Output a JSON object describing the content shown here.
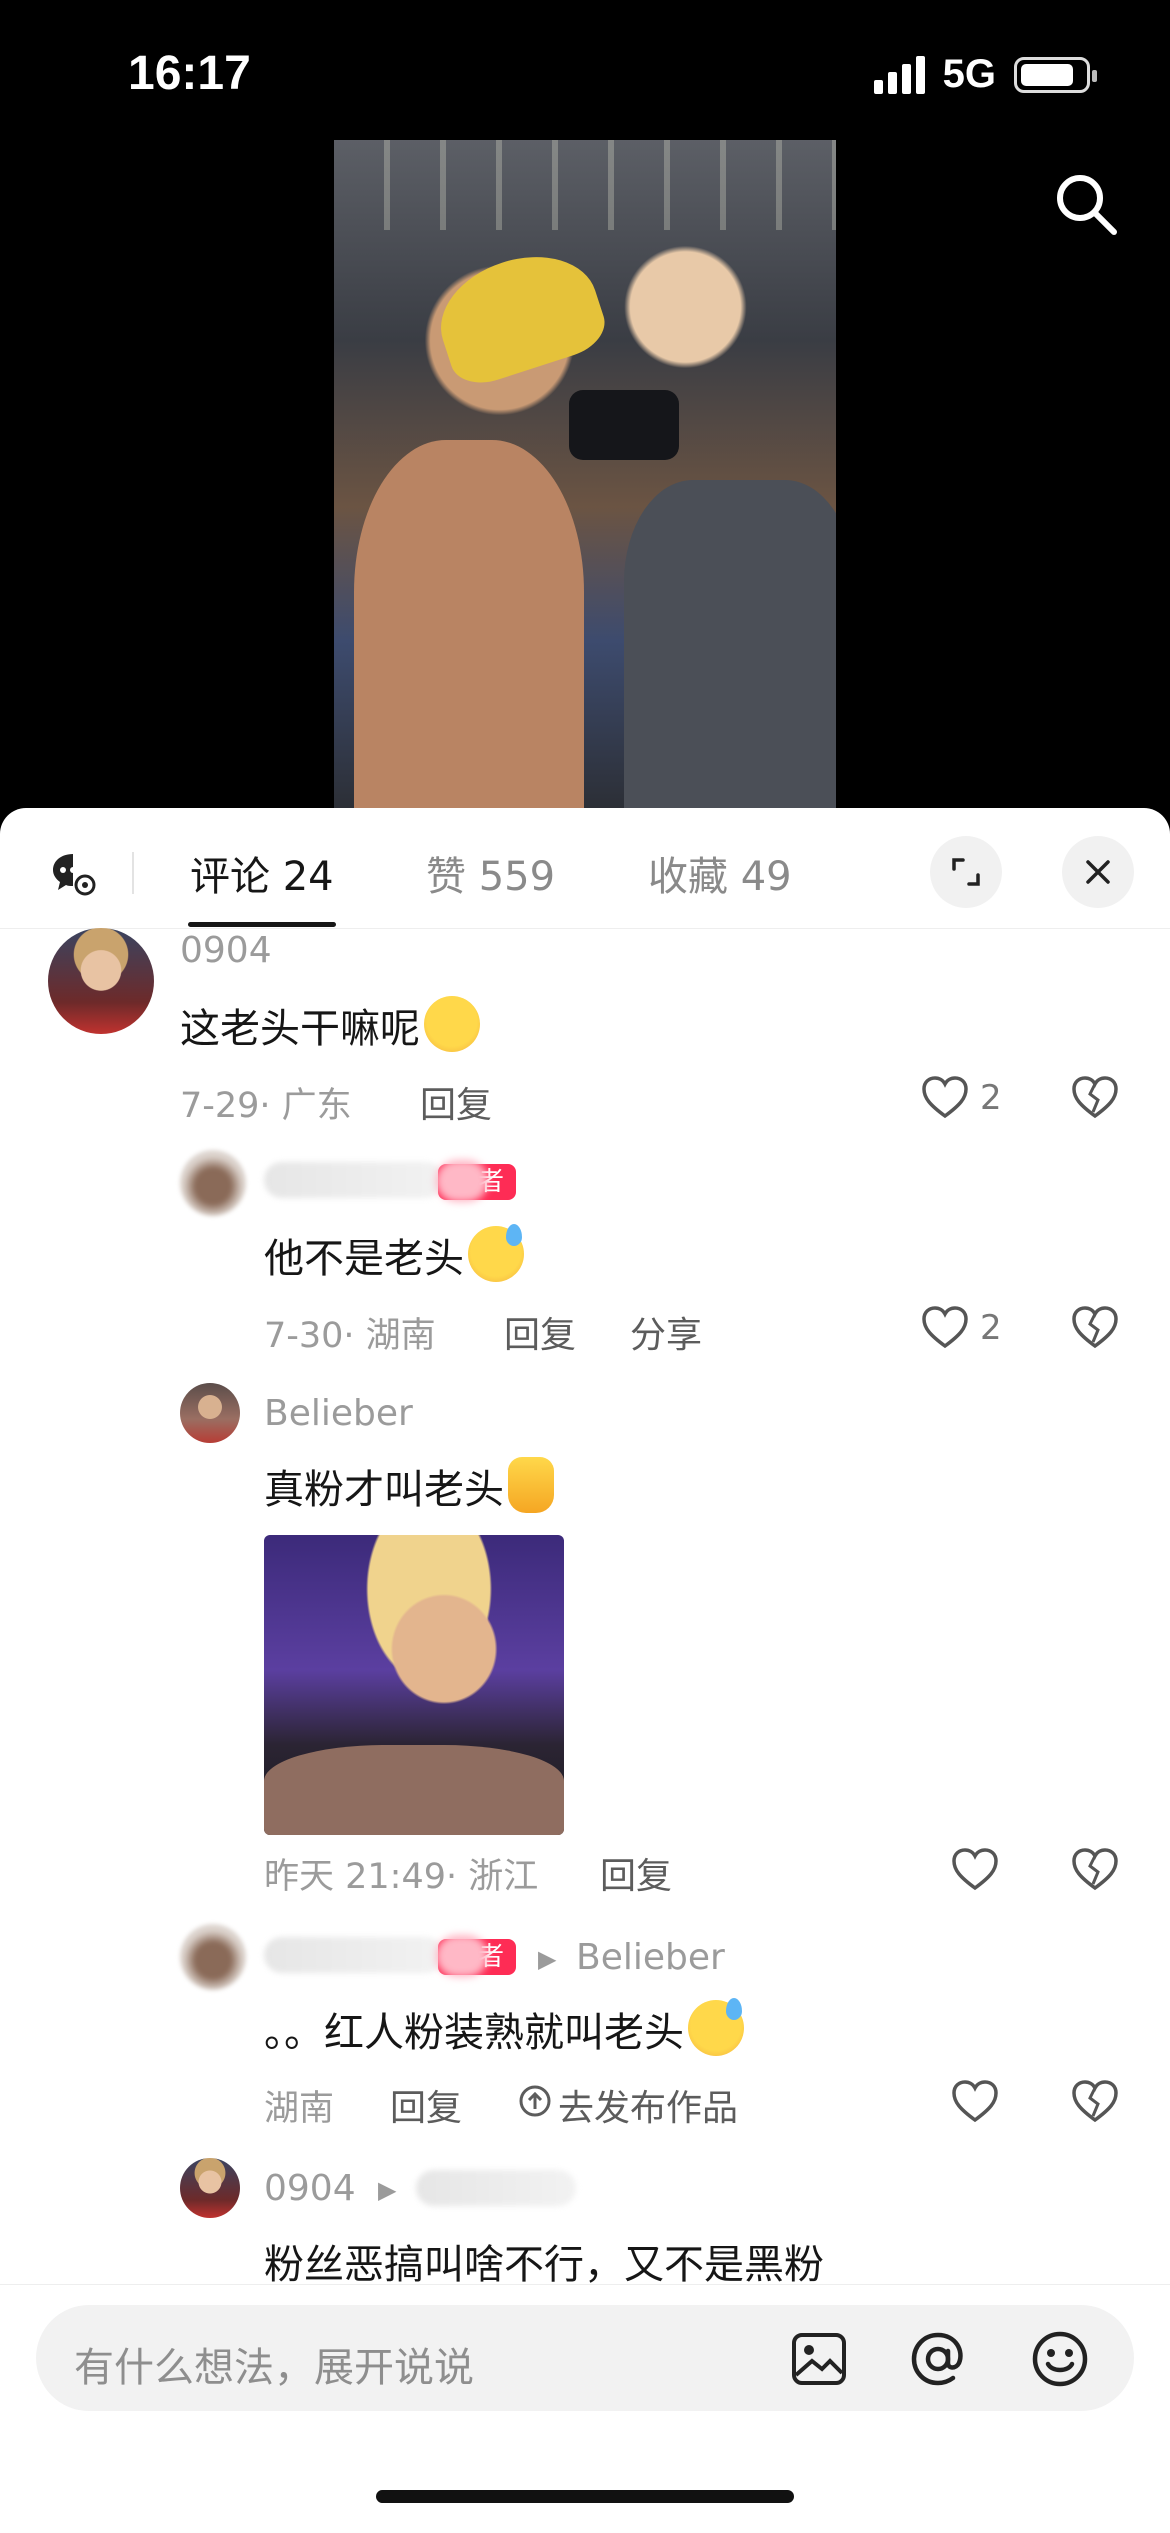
{
  "status": {
    "time": "16:17",
    "network": "5G"
  },
  "tabs": [
    {
      "label": "评论 24"
    },
    {
      "label": "赞 559"
    },
    {
      "label": "收藏 49"
    }
  ],
  "comments": [
    {
      "username": "0904",
      "text": "这老头干嘛呢",
      "date_loc": "7-29· 广东",
      "reply": "回复",
      "likes": "2"
    },
    {
      "tag": "者",
      "text": "他不是老头",
      "date_loc": "7-30· 湖南",
      "reply": "回复",
      "share": "分享",
      "likes": "2"
    },
    {
      "username": "Belieber",
      "text": "真粉才叫老头",
      "date_loc": "昨天 21:49· 浙江",
      "reply": "回复"
    },
    {
      "tag": "者",
      "reply_to": "Belieber",
      "text": "。。红人粉装熟就叫老头",
      "date_loc": "湖南",
      "reply": "回复",
      "publish": "去发布作品"
    },
    {
      "username": "0904",
      "text": "粉丝恶搞叫啥不行，又不是黑粉"
    }
  ],
  "input": {
    "placeholder": "有什么想法，展开说说"
  },
  "colors": {
    "accent": "#fe2c55",
    "text": "#161616",
    "muted": "#9b9b9b"
  }
}
